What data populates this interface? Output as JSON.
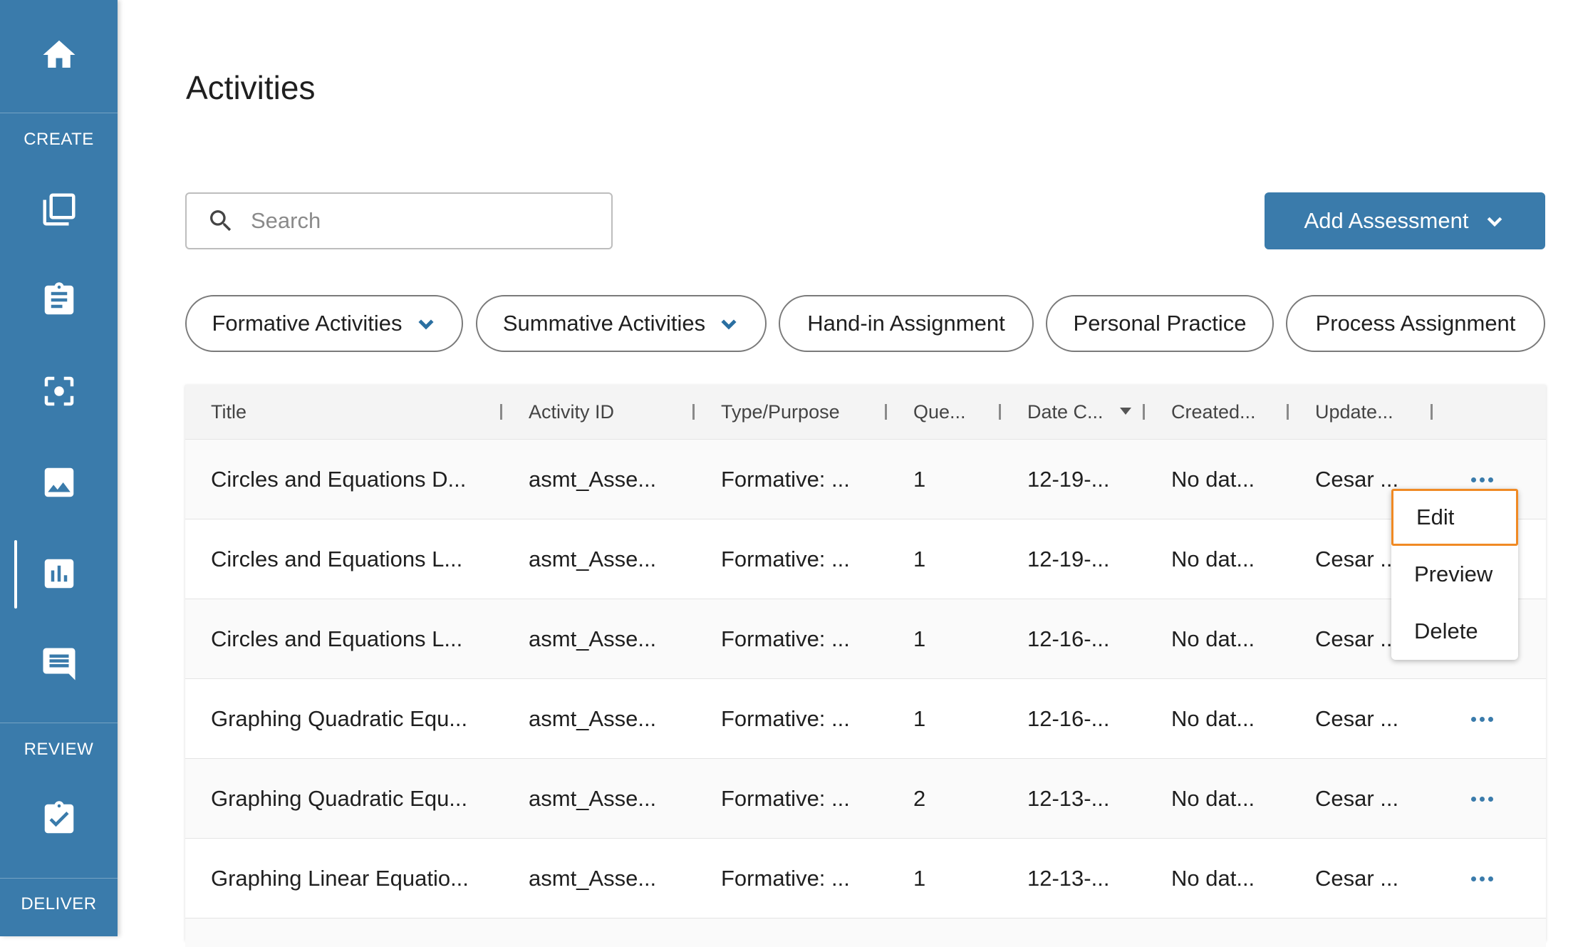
{
  "sidebar": {
    "home_icon": "home-icon",
    "create_label": "CREATE",
    "review_label": "REVIEW",
    "deliver_label": "DELIVER",
    "items": [
      {
        "icon": "library-icon"
      },
      {
        "icon": "clipboard-icon"
      },
      {
        "icon": "focus-scan-icon"
      },
      {
        "icon": "image-icon"
      },
      {
        "icon": "bar-chart-icon",
        "active": true
      },
      {
        "icon": "message-icon"
      },
      {
        "icon": "clipboard-check-icon"
      }
    ],
    "color": "#3a7bab"
  },
  "page": {
    "title": "Activities"
  },
  "search": {
    "placeholder": "Search",
    "value": ""
  },
  "add_button": {
    "label": "Add Assessment"
  },
  "filters": [
    {
      "label": "Formative Activities",
      "dropdown": true
    },
    {
      "label": "Summative Activities",
      "dropdown": true
    },
    {
      "label": "Hand-in Assignment",
      "dropdown": false
    },
    {
      "label": "Personal Practice",
      "dropdown": false
    },
    {
      "label": "Process Assignment",
      "dropdown": false
    }
  ],
  "table": {
    "columns": [
      "Title",
      "Activity ID",
      "Type/Purpose",
      "Que...",
      "Date C...",
      "Created...",
      "Update..."
    ],
    "sort_column": "Date C...",
    "rows": [
      [
        "Circles and Equations D...",
        "asmt_Asse...",
        "Formative: ...",
        "1",
        "12-19-...",
        "No dat...",
        "Cesar ..."
      ],
      [
        "Circles and Equations L...",
        "asmt_Asse...",
        "Formative: ...",
        "1",
        "12-19-...",
        "No dat...",
        "Cesar ..."
      ],
      [
        "Circles and Equations L...",
        "asmt_Asse...",
        "Formative: ...",
        "1",
        "12-16-...",
        "No dat...",
        "Cesar ..."
      ],
      [
        "Graphing Quadratic Equ...",
        "asmt_Asse...",
        "Formative: ...",
        "1",
        "12-16-...",
        "No dat...",
        "Cesar ..."
      ],
      [
        "Graphing Quadratic Equ...",
        "asmt_Asse...",
        "Formative: ...",
        "2",
        "12-13-...",
        "No dat...",
        "Cesar ..."
      ],
      [
        "Graphing Linear Equatio...",
        "asmt_Asse...",
        "Formative: ...",
        "1",
        "12-13-...",
        "No dat...",
        "Cesar ..."
      ]
    ]
  },
  "context_menu": {
    "items": [
      "Edit",
      "Preview",
      "Delete"
    ],
    "focused": "Edit",
    "focus_color": "#f08a24"
  }
}
